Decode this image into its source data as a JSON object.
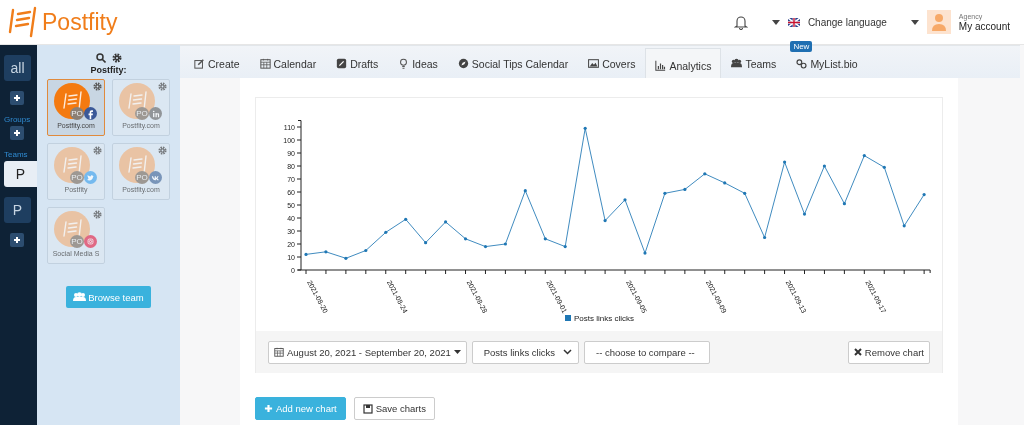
{
  "header": {
    "brand": "Postfity",
    "language": "Change language",
    "account_role": "Agency",
    "account_label": "My account"
  },
  "sidebar": {
    "items": [
      {
        "kind": "button",
        "label": "all",
        "selected": false
      },
      {
        "kind": "add"
      },
      {
        "kind": "heading",
        "label": "Groups"
      },
      {
        "kind": "add"
      },
      {
        "kind": "heading",
        "label": "Teams"
      },
      {
        "kind": "button",
        "label": "P",
        "selected": true
      },
      {
        "kind": "button",
        "label": "P",
        "selected": false
      },
      {
        "kind": "add"
      }
    ]
  },
  "team_panel": {
    "title": "Postfity:",
    "browse_button": "Browse team",
    "accounts": [
      {
        "name": "Postfity.com",
        "badge": "PO",
        "kind": "facebook",
        "selected": true
      },
      {
        "name": "Postfity.com",
        "badge": "PO",
        "kind": "linkedin",
        "selected": false
      },
      {
        "name": "Postfity",
        "badge": "PO",
        "kind": "twitter",
        "selected": false
      },
      {
        "name": "Postfity.com",
        "badge": "PO",
        "kind": "vk",
        "selected": false
      },
      {
        "name": "Social Media S",
        "badge": "PO",
        "kind": "instagram",
        "selected": false
      }
    ]
  },
  "tabs": [
    {
      "label": "Create",
      "selected": false
    },
    {
      "label": "Calendar",
      "selected": false
    },
    {
      "label": "Drafts",
      "selected": false
    },
    {
      "label": "Ideas",
      "selected": false
    },
    {
      "label": "Social Tips Calendar",
      "selected": false
    },
    {
      "label": "Covers",
      "selected": false
    },
    {
      "label": "Analytics",
      "selected": true
    },
    {
      "label": "Teams",
      "selected": false
    },
    {
      "label": "MyList.bio",
      "selected": false,
      "badge": "New"
    }
  ],
  "chart_panel": {
    "chart_data": {
      "type": "line",
      "categories": [
        "2021-08-20",
        null,
        null,
        null,
        "2021-08-24",
        null,
        null,
        null,
        "2021-08-28",
        null,
        null,
        null,
        "2021-09-01",
        null,
        null,
        null,
        "2021-09-05",
        null,
        null,
        null,
        "2021-09-09",
        null,
        null,
        null,
        "2021-09-13",
        null,
        null,
        null,
        "2021-09-17",
        null,
        null,
        null
      ],
      "series": [
        {
          "name": "Posts links clicks",
          "color": "#1f77b4",
          "values": [
            12,
            14,
            9,
            15,
            29,
            39,
            21,
            37,
            24,
            18,
            20,
            61,
            24,
            18,
            109,
            38,
            54,
            13,
            59,
            62,
            74,
            67,
            59,
            25,
            83,
            43,
            80,
            51,
            88,
            79,
            34,
            58
          ]
        }
      ],
      "ylim": [
        0,
        115
      ],
      "yticks": [
        0,
        10,
        20,
        30,
        40,
        50,
        60,
        70,
        80,
        90,
        100,
        110
      ]
    },
    "date_range": "August 20, 2021 - September 20, 2021",
    "metric": "Posts links clicks",
    "compare": "-- choose to compare --",
    "remove_button": "Remove chart"
  },
  "buttons": [
    {
      "kind": "primary",
      "label": "Add new chart"
    },
    {
      "kind": "default",
      "label": "Save charts"
    }
  ]
}
